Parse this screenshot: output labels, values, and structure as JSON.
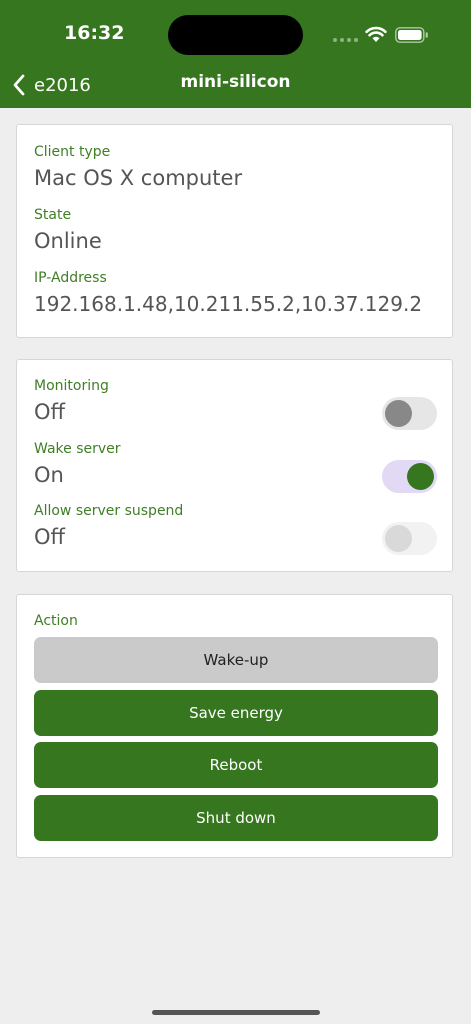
{
  "status_bar": {
    "time": "16:32"
  },
  "nav": {
    "back_label": "e2016",
    "title": "mini-silicon"
  },
  "info": {
    "client_type_label": "Client type",
    "client_type_value": "Mac OS X computer",
    "state_label": "State",
    "state_value": "Online",
    "ip_label": "IP-Address",
    "ip_value": "192.168.1.48,10.211.55.2,10.37.129.2"
  },
  "settings": {
    "monitoring_label": "Monitoring",
    "monitoring_value": "Off",
    "monitoring_enabled": false,
    "wake_server_label": "Wake server",
    "wake_server_value": "On",
    "wake_server_enabled": true,
    "allow_suspend_label": "Allow server suspend",
    "allow_suspend_value": "Off",
    "allow_suspend_enabled": false
  },
  "actions": {
    "title": "Action",
    "wake_up_label": "Wake-up",
    "save_energy_label": "Save energy",
    "reboot_label": "Reboot",
    "shut_down_label": "Shut down"
  },
  "colors": {
    "brand_green": "#35761f",
    "label_green": "#3f7f26",
    "background": "#eeeeee"
  }
}
